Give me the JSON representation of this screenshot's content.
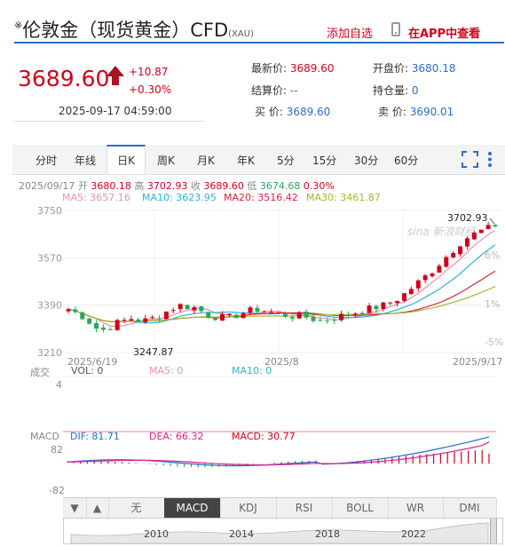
{
  "title": {
    "mark": "※",
    "name": "伦敦金（现货黄金）CFD",
    "sub": "(XAU)"
  },
  "actions": {
    "add_watch": "添加自选",
    "view_app": "在APP中查看"
  },
  "quote": {
    "price": "3689.60",
    "change": "+10.87",
    "change_pct": "+0.30%",
    "timestamp": "2025-09-17 04:59:00"
  },
  "info": [
    {
      "label": "最新价:",
      "value": "3689.60"
    },
    {
      "label": "开盘价:",
      "value": "3680.18"
    },
    {
      "label": "结算价:",
      "value": "--"
    },
    {
      "label": "持仓量:",
      "value": "0"
    },
    {
      "label": "买  价:",
      "value": "3689.60"
    },
    {
      "label": "卖  价:",
      "value": "3690.01"
    }
  ],
  "tabs": [
    "分时",
    "年线",
    "日K",
    "周K",
    "月K",
    "年K",
    "5分",
    "15分",
    "30分",
    "60分"
  ],
  "active_tab": "日K",
  "ohlc": {
    "date": "2025/09/17",
    "open_label": "开",
    "open": "3680.18",
    "high_label": "高",
    "high": "3702.93",
    "close_label": "收",
    "close": "3689.60",
    "low_label": "低",
    "low": "3674.68",
    "pct": "0.30%"
  },
  "ma": {
    "ma5": "MA5: 3657.16",
    "ma10": "MA10: 3623.95",
    "ma20": "MA20: 3516.42",
    "ma30": "MA30: 3461.87"
  },
  "y_axis": [
    "3750",
    "3570",
    "3390",
    "3210"
  ],
  "pct_axis": [
    "6%",
    "1%",
    "-5%"
  ],
  "annotations": {
    "high": "3702.93",
    "low": "3247.87"
  },
  "x_axis": [
    "2025/6/19",
    "2025/8",
    "2025/9/17"
  ],
  "watermark": "sina 新浪财经",
  "volume": {
    "label": "成交",
    "scale": "4",
    "vol": "VOL: 0",
    "ma5": "MA5: 0",
    "ma10": "MA10: 0"
  },
  "macd": {
    "label": "MACD",
    "dif": "DIF: 81.71",
    "dea": "DEA: 66.32",
    "macd": "MACD: 30.77",
    "top": "82",
    "bottom": "-82"
  },
  "indicator_tabs": [
    "无",
    "MACD",
    "KDJ",
    "RSI",
    "BOLL",
    "WR",
    "DMI"
  ],
  "active_indicator": "MACD",
  "nav_arrows": {
    "down": "▼",
    "up": "▲"
  },
  "timeline": [
    "2010",
    "2014",
    "2018",
    "2022"
  ],
  "colors": {
    "up": "#d0021b",
    "down": "#2aa85a",
    "accent": "#2a6fc9",
    "ma5": "#e891b0",
    "ma10": "#2db3d6",
    "ma20": "#d8243a",
    "ma30": "#a4b82a"
  },
  "chart_data": {
    "type": "candlestick",
    "title": "",
    "x_range": [
      "2025/6/19",
      "2025/9/17"
    ],
    "ylim": [
      3210,
      3750
    ],
    "last": {
      "open": 3680.18,
      "high": 3702.93,
      "low": 3674.68,
      "close": 3689.6
    },
    "period_high": 3702.93,
    "period_low": 3247.87,
    "series": [
      {
        "name": "MA5",
        "value": 3657.16
      },
      {
        "name": "MA10",
        "value": 3623.95
      },
      {
        "name": "MA20",
        "value": 3516.42
      },
      {
        "name": "MA30",
        "value": 3461.87
      }
    ],
    "macd": {
      "dif": 81.71,
      "dea": 66.32,
      "macd": 30.77,
      "range": [
        -82,
        82
      ]
    }
  }
}
